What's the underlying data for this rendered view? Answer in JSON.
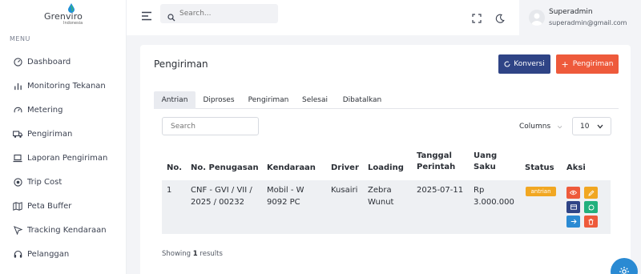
{
  "brand": {
    "name": "Grenviro",
    "sub": "Indonesia"
  },
  "sidebar": {
    "menu_title": "MENU",
    "items": [
      {
        "label": "Dashboard",
        "icon": "dashboard-icon"
      },
      {
        "label": "Monitoring Tekanan",
        "icon": "bar-chart-icon"
      },
      {
        "label": "Metering",
        "icon": "gauge-icon"
      },
      {
        "label": "Pengiriman",
        "icon": "truck-icon"
      },
      {
        "label": "Laporan Pengiriman",
        "icon": "laptop-icon"
      },
      {
        "label": "Trip Cost",
        "icon": "target-icon"
      },
      {
        "label": "Peta Buffer",
        "icon": "map-icon"
      },
      {
        "label": "Tracking Kendaraan",
        "icon": "navigation-icon"
      },
      {
        "label": "Pelanggan",
        "icon": "headset-icon"
      }
    ]
  },
  "header": {
    "search_placeholder": "Search...",
    "user_name": "Superadmin",
    "user_email": "superadmin@gmail.com"
  },
  "page": {
    "title": "Pengiriman",
    "konversi_label": "Konversi",
    "add_label": "Pengiriman",
    "tabs": [
      "Antrian",
      "Diproses",
      "Pengiriman",
      "Selesai",
      "Dibatalkan"
    ],
    "active_tab": "Antrian"
  },
  "table": {
    "search_placeholder": "Search",
    "columns_label": "Columns",
    "page_size": "10",
    "headers": {
      "no": "No.",
      "penugasan": "No. Penugasan",
      "kendaraan": "Kendaraan",
      "driver": "Driver",
      "loading": "Loading",
      "tanggal_1": "Tanggal",
      "tanggal_2": "Perintah",
      "uang_1": "Uang",
      "uang_2": "Saku",
      "status": "Status",
      "aksi": "Aksi"
    },
    "rows": [
      {
        "no": "1",
        "penugasan_1": "CNF - GVI / VII /",
        "penugasan_2": "2025 / 00232",
        "kendaraan_1": "Mobil - W",
        "kendaraan_2": "9092 PC",
        "driver": "Kusairi",
        "loading_1": "Zebra",
        "loading_2": "Wunut",
        "tanggal": "2025-07-11",
        "uang_1": "Rp",
        "uang_2": "3.000.000",
        "status": "antrian"
      }
    ],
    "footer_prefix": "Showing",
    "footer_count": "1",
    "footer_suffix": "results"
  },
  "colors": {
    "primary": "#2f4486",
    "danger": "#ee5a3b",
    "warning": "#f1a722",
    "success": "#22b07d",
    "info": "#2a8ad3"
  }
}
